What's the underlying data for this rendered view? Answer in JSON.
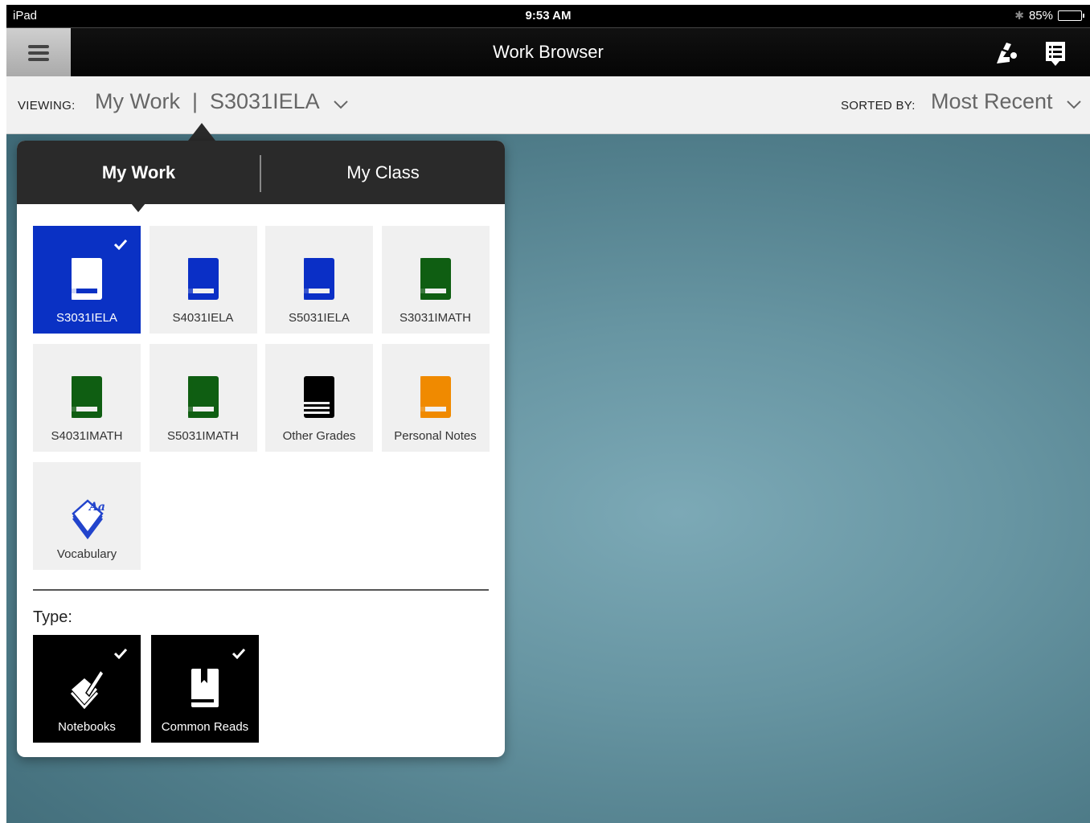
{
  "status": {
    "device": "iPad",
    "time": "9:53 AM",
    "battery": "85%",
    "battery_level": 0.85
  },
  "nav": {
    "title": "Work Browser"
  },
  "filter": {
    "viewing_label": "VIEWING:",
    "viewing_value": "My Work  |  S3031IELA",
    "sorted_label": "SORTED BY:",
    "sorted_value": "Most Recent"
  },
  "tabs": [
    {
      "label": "My Work"
    },
    {
      "label": "My Class"
    }
  ],
  "collections": [
    {
      "name": "S3031IELA",
      "color": "#ffffff",
      "icon": "book-icon",
      "selected": true
    },
    {
      "name": "S4031IELA",
      "color": "#0a2fc6",
      "icon": "book-icon"
    },
    {
      "name": "S5031IELA",
      "color": "#0a2fc6",
      "icon": "book-icon"
    },
    {
      "name": "S3031IMATH",
      "color": "#0f5e12",
      "icon": "book-icon"
    },
    {
      "name": "S4031IMATH",
      "color": "#0f5e12",
      "icon": "book-icon"
    },
    {
      "name": "S5031IMATH",
      "color": "#0f5e12",
      "icon": "book-icon"
    },
    {
      "name": "Other Grades",
      "color": "#000000",
      "icon": "book-stack-icon"
    },
    {
      "name": "Personal Notes",
      "color": "#f08a00",
      "icon": "book-icon"
    },
    {
      "name": "Vocabulary",
      "color": "#2244cc",
      "icon": "vocabulary-icon"
    }
  ],
  "type_section": {
    "label": "Type:",
    "items": [
      {
        "name": "Notebooks",
        "icon": "notebook-pen-icon",
        "selected": true
      },
      {
        "name": "Common Reads",
        "icon": "open-book-icon",
        "selected": true
      }
    ]
  }
}
